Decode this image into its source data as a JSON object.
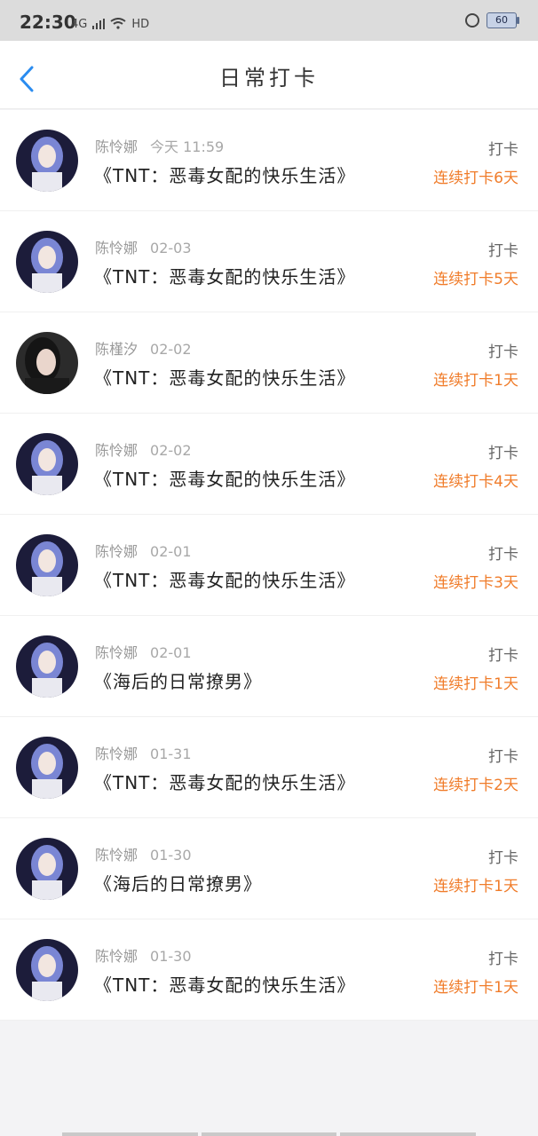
{
  "status_bar": {
    "time": "22:30",
    "network": "4G",
    "hd": "HD",
    "battery": "60"
  },
  "header": {
    "title": "日常打卡",
    "back_icon": "chevron-left-icon"
  },
  "colors": {
    "accent_blue": "#2a8cf0",
    "streak_orange": "#f07c2a"
  },
  "entries": [
    {
      "name": "陈怜娜",
      "date": "今天 11:59",
      "book": "《TNT：恶毒女配的快乐生活》",
      "action": "打卡",
      "streak": "连续打卡6天",
      "avatar": "avatar-blue-hair"
    },
    {
      "name": "陈怜娜",
      "date": "02-03",
      "book": "《TNT：恶毒女配的快乐生活》",
      "action": "打卡",
      "streak": "连续打卡5天",
      "avatar": "avatar-blue-hair"
    },
    {
      "name": "陈槿汐",
      "date": "02-02",
      "book": "《TNT：恶毒女配的快乐生活》",
      "action": "打卡",
      "streak": "连续打卡1天",
      "avatar": "avatar-dark-hair"
    },
    {
      "name": "陈怜娜",
      "date": "02-02",
      "book": "《TNT：恶毒女配的快乐生活》",
      "action": "打卡",
      "streak": "连续打卡4天",
      "avatar": "avatar-blue-hair"
    },
    {
      "name": "陈怜娜",
      "date": "02-01",
      "book": "《TNT：恶毒女配的快乐生活》",
      "action": "打卡",
      "streak": "连续打卡3天",
      "avatar": "avatar-blue-hair"
    },
    {
      "name": "陈怜娜",
      "date": "02-01",
      "book": "《海后的日常撩男》",
      "action": "打卡",
      "streak": "连续打卡1天",
      "avatar": "avatar-blue-hair"
    },
    {
      "name": "陈怜娜",
      "date": "01-31",
      "book": "《TNT：恶毒女配的快乐生活》",
      "action": "打卡",
      "streak": "连续打卡2天",
      "avatar": "avatar-blue-hair"
    },
    {
      "name": "陈怜娜",
      "date": "01-30",
      "book": "《海后的日常撩男》",
      "action": "打卡",
      "streak": "连续打卡1天",
      "avatar": "avatar-blue-hair"
    },
    {
      "name": "陈怜娜",
      "date": "01-30",
      "book": "《TNT：恶毒女配的快乐生活》",
      "action": "打卡",
      "streak": "连续打卡1天",
      "avatar": "avatar-blue-hair"
    }
  ]
}
